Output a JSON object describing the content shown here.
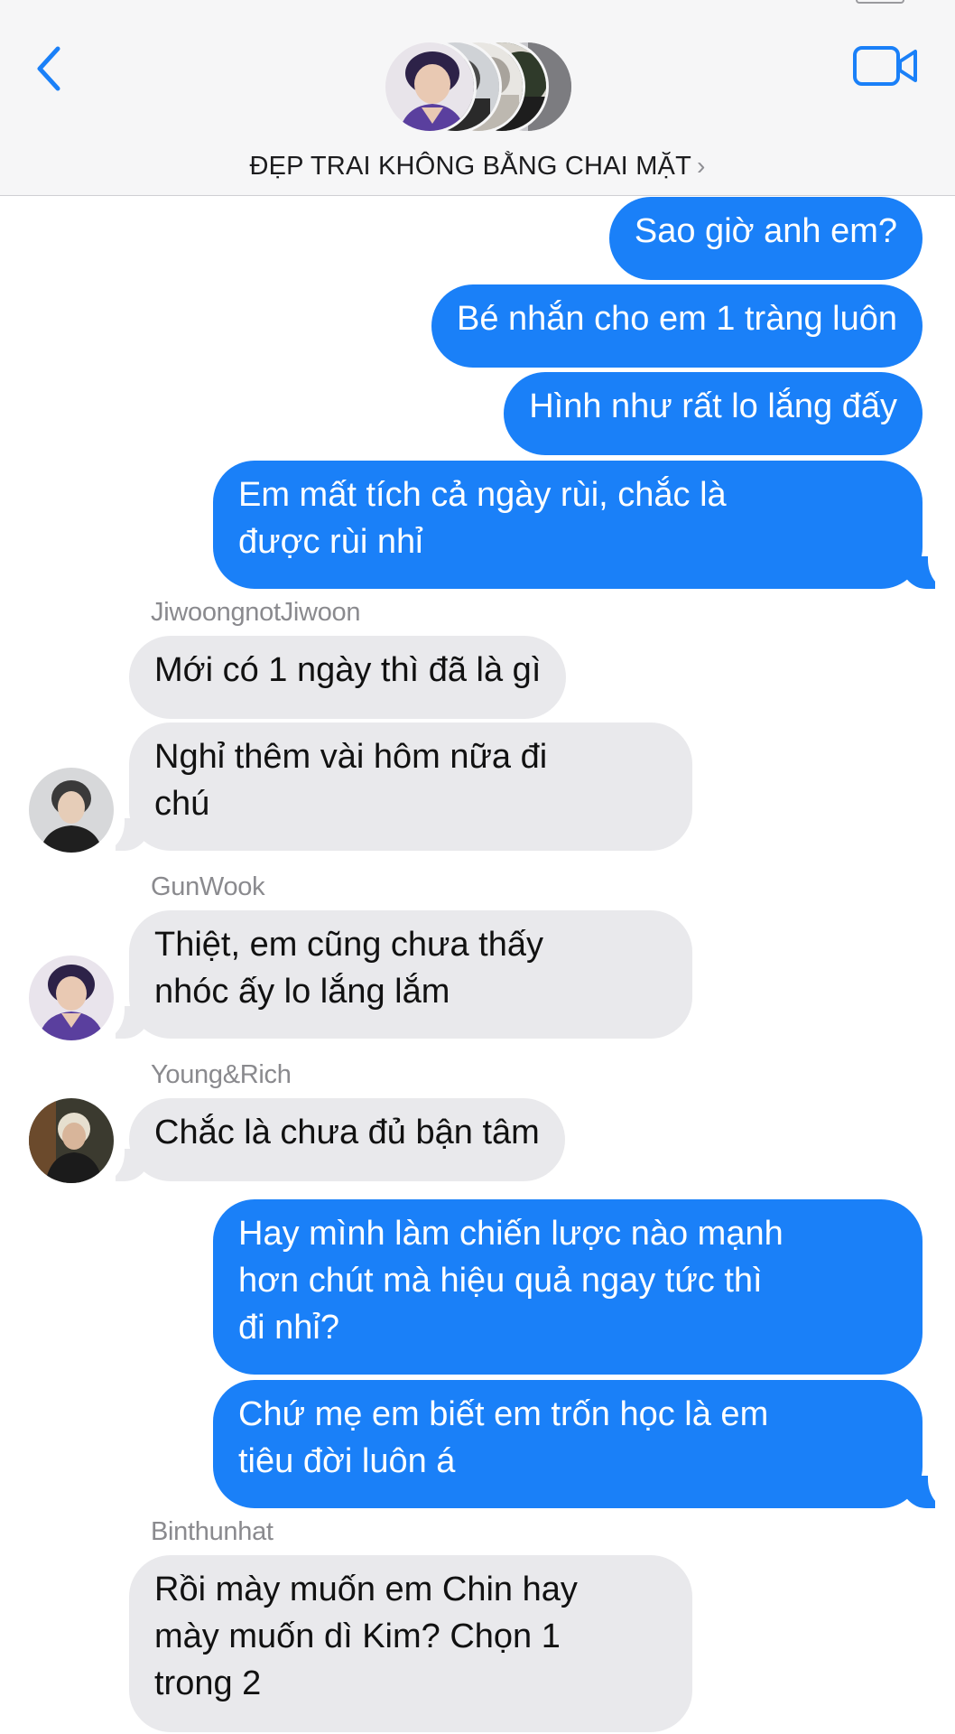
{
  "header": {
    "group_name": "ĐẸP TRAI KHÔNG BẰNG CHAI MẶT",
    "chevron": "›",
    "back_icon": "chevron-left-icon",
    "video_icon": "video-camera-icon",
    "accent": "#1a80f8"
  },
  "messages": [
    {
      "dir": "out",
      "text": "Sao giờ anh em?"
    },
    {
      "dir": "out",
      "text": "Bé nhắn cho em 1 tràng luôn"
    },
    {
      "dir": "out",
      "text": "Hình như rất lo lắng đấy"
    },
    {
      "dir": "out",
      "lines": [
        "Em mất tích cả ngày rùi, chắc là",
        "được rùi nhỉ"
      ]
    },
    {
      "dir": "in",
      "sender": "JiwoongnotJiwoon",
      "text": "Mới có 1 ngày thì đã là gì"
    },
    {
      "dir": "in",
      "lines": [
        "Nghỉ thêm vài hôm nữa đi",
        "chú"
      ]
    },
    {
      "dir": "in",
      "sender": "GunWook",
      "lines": [
        "Thiệt, em cũng chưa thấy",
        "nhóc ấy lo lắng lắm"
      ]
    },
    {
      "dir": "in",
      "sender": "Young&Rich",
      "text": "Chắc là chưa đủ bận tâm"
    },
    {
      "dir": "out",
      "lines": [
        "Hay mình làm chiến lược nào mạnh",
        "hơn chút mà hiệu quả ngay tức thì",
        "đi nhỉ?"
      ]
    },
    {
      "dir": "out",
      "lines": [
        "Chứ mẹ em biết em trốn học là em",
        "tiêu đời luôn á"
      ]
    },
    {
      "dir": "in",
      "sender": "Binthunhat",
      "lines": [
        "Rồi mày muốn em Chin hay",
        "mày muốn dì Kim? Chọn 1",
        "trong 2"
      ]
    }
  ],
  "colors": {
    "outgoing_bubble": "#1a80f8",
    "incoming_bubble": "#e9e9ec",
    "sender_name": "#8a8a8e"
  }
}
